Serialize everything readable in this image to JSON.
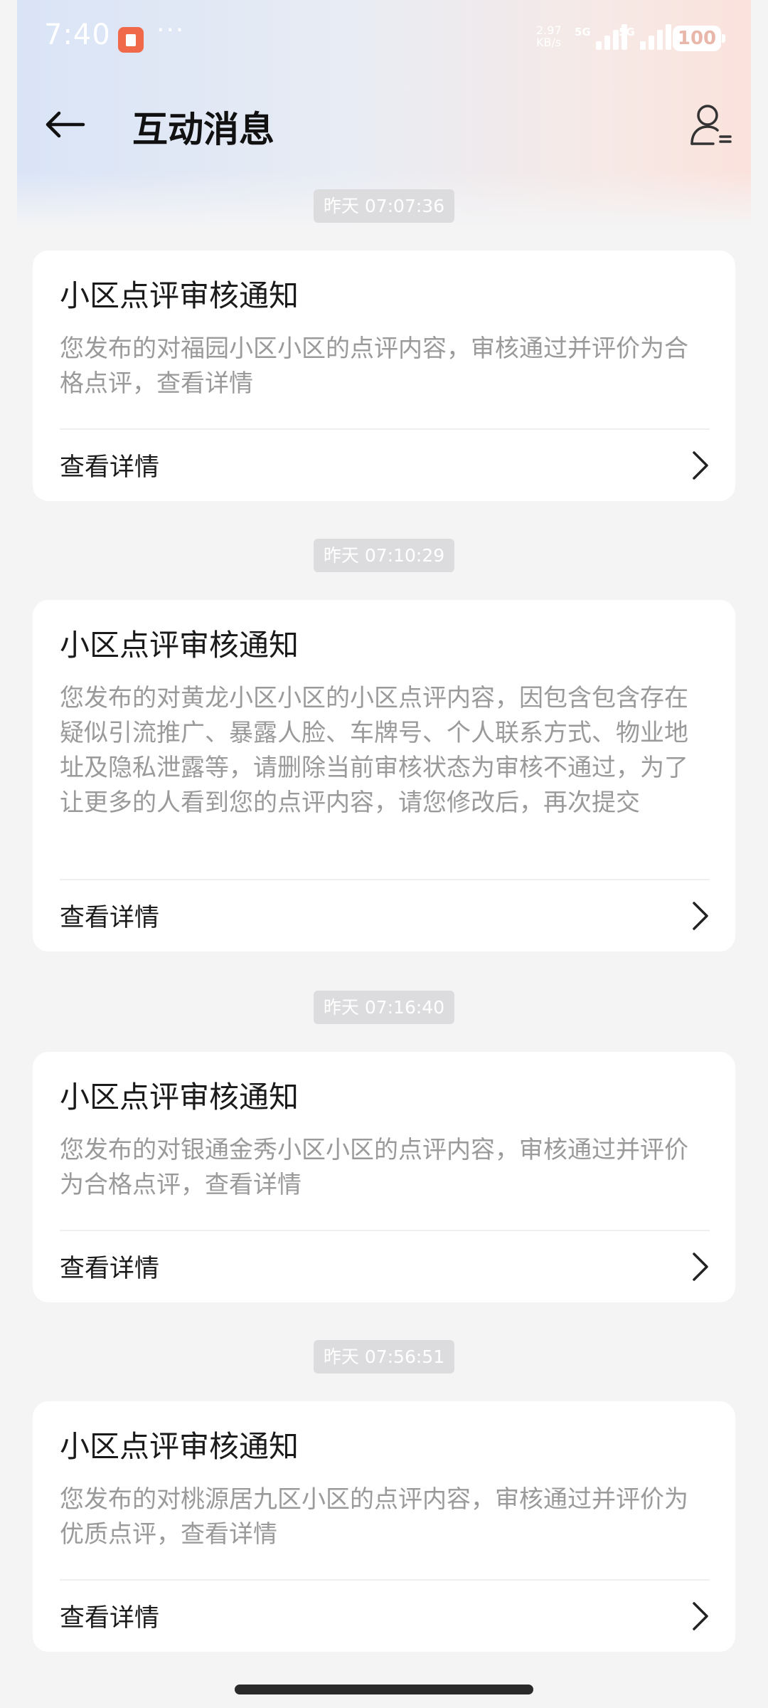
{
  "status_bar": {
    "time": "7:40",
    "more": "···",
    "net_speed_value": "2.97",
    "net_speed_unit": "KB/s",
    "network_1": "5G",
    "network_2": "5G",
    "battery": "100"
  },
  "header": {
    "title": "互动消息",
    "back_icon": "arrow-left-icon",
    "profile_icon": "user-settings-icon"
  },
  "messages": [
    {
      "timestamp": "昨天 07:07:36",
      "title": "小区点评审核通知",
      "body": "您发布的对福园小区小区的点评内容，审核通过并评价为合格点评，查看详情",
      "link_label": "查看详情"
    },
    {
      "timestamp": "昨天 07:10:29",
      "title": "小区点评审核通知",
      "body": "您发布的对黄龙小区小区的小区点评内容，因包含包含存在疑似引流推广、暴露人脸、车牌号、个人联系方式、物业地址及隐私泄露等，请删除当前审核状态为审核不通过，为了让更多的人看到您的点评内容，请您修改后，再次提交",
      "link_label": "查看详情"
    },
    {
      "timestamp": "昨天 07:16:40",
      "title": "小区点评审核通知",
      "body": "您发布的对银通金秀小区小区的点评内容，审核通过并评价为合格点评，查看详情",
      "link_label": "查看详情"
    },
    {
      "timestamp": "昨天 07:56:51",
      "title": "小区点评审核通知",
      "body": "您发布的对桃源居九区小区的点评内容，审核通过并评价为优质点评，查看详情",
      "link_label": "查看详情"
    }
  ]
}
